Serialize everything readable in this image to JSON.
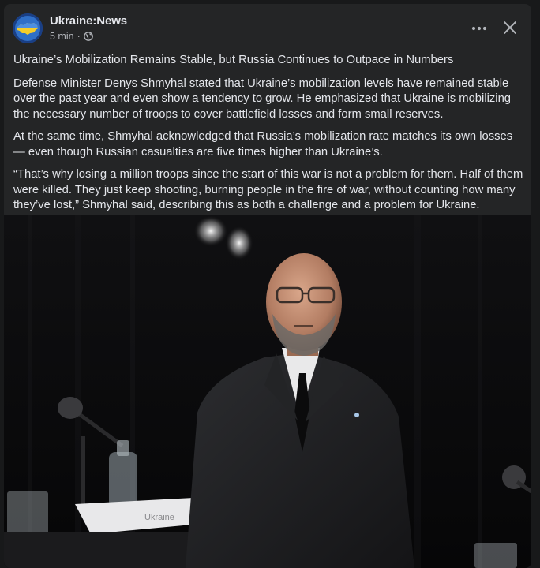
{
  "post": {
    "page_name": "Ukraine:News",
    "time": "5 min",
    "separator": "·",
    "privacy_icon": "globe-icon",
    "more_icon": "more-icon",
    "close_icon": "close-icon",
    "title": "Ukraine’s Mobilization Remains Stable, but Russia Continues to Outpace in Numbers",
    "paragraphs": [
      "Defense Minister Denys Shmyhal stated that Ukraine’s mobilization levels have remained stable over the past year and even show a tendency to grow. He emphasized that Ukraine is mobilizing the necessary number of troops to cover battlefield losses and form small reserves.",
      "At the same time, Shmyhal acknowledged that Russia’s mobilization rate matches its own losses — even though Russian casualties are five times higher than Ukraine’s.",
      "“That’s why losing a million troops since the start of this war is not a problem for them. Half of them were killed. They just keep shooting, burning people in the fire of war, without counting how many they’ve lost,” Shmyhal said, describing this as both a challenge and a problem for Ukraine."
    ],
    "photo_placard": "Ukraine"
  },
  "colors": {
    "background": "#18191a",
    "card": "#242526",
    "text": "#e4e6eb",
    "muted": "#b0b3b8",
    "flag_blue": "#1d5fb0",
    "flag_yellow": "#f5cd2a"
  }
}
